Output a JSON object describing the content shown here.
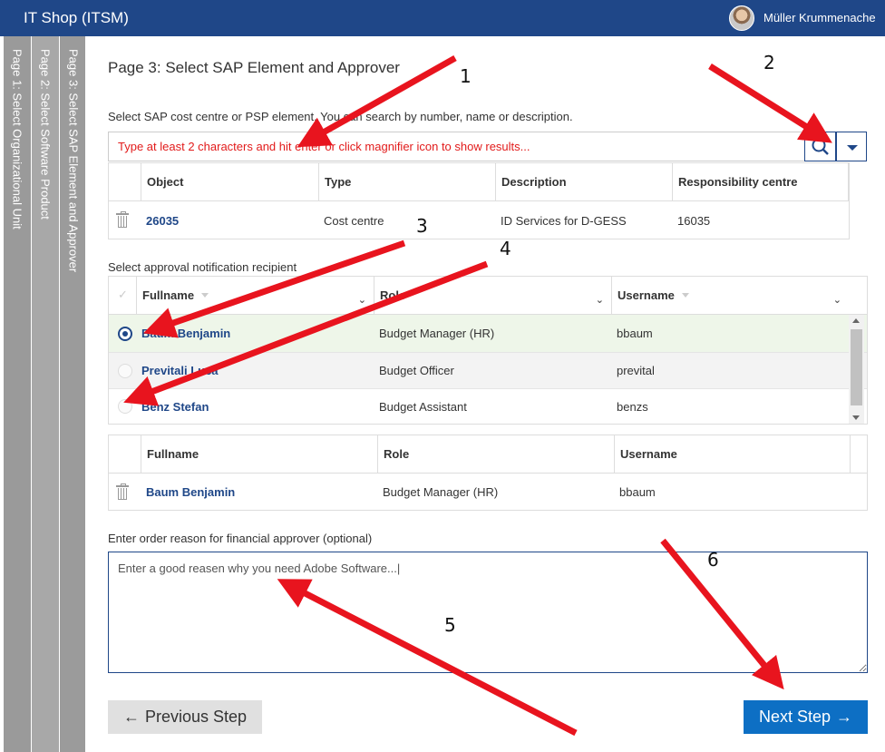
{
  "header": {
    "app_title": "IT Shop (ITSM)",
    "user_name": "Müller Krummenache"
  },
  "steps": [
    {
      "label": "Page 1: Select Organizational Unit"
    },
    {
      "label": "Page 2: Select Software Product"
    },
    {
      "label": "Page 3: Select SAP Element and Approver"
    }
  ],
  "page": {
    "title": "Page 3: Select SAP Element and Approver",
    "sap_prompt": "Select SAP cost centre or PSP element. You can search by number, name or description.",
    "sap_search_placeholder": "Type at least 2 characters and hit enter or click magnifier icon to show results...",
    "approval_prompt": "Select approval notification recipient",
    "reason_prompt": "Enter order reason for financial approver (optional)",
    "reason_value": "Enter a good reasen why you need Adobe Software...|"
  },
  "sap_table": {
    "columns": [
      "Object",
      "Type",
      "Description",
      "Responsibility centre"
    ],
    "rows": [
      {
        "object": "26035",
        "type": "Cost centre",
        "description": "ID Services for D-GESS",
        "responsibility": "16035"
      }
    ]
  },
  "approver_table": {
    "columns": [
      "Fullname",
      "Role",
      "Username"
    ],
    "rows": [
      {
        "fullname": "Baum Benjamin",
        "role": "Budget Manager (HR)",
        "username": "bbaum",
        "selected": true
      },
      {
        "fullname": "Previtali Luca",
        "role": "Budget Officer",
        "username": "prevital",
        "selected": false
      },
      {
        "fullname": "Benz Stefan",
        "role": "Budget Assistant",
        "username": "benzs",
        "selected": false
      }
    ]
  },
  "selected_table": {
    "columns": [
      "Fullname",
      "Role",
      "Username"
    ],
    "rows": [
      {
        "fullname": "Baum Benjamin",
        "role": "Budget Manager (HR)",
        "username": "bbaum"
      }
    ]
  },
  "buttons": {
    "previous": "Previous Step",
    "next": "Next Step",
    "arrow_left": "←",
    "arrow_right": "→"
  },
  "annotations": [
    "1",
    "2",
    "3",
    "4",
    "5",
    "6"
  ],
  "colors": {
    "header_bg": "#1f4788",
    "link": "#1f4788",
    "placeholder": "#e21b1b",
    "next_button": "#0d6fc4",
    "annotation_arrow": "#e8141e"
  },
  "icons": [
    "magnifier-icon",
    "dropdown-arrow-icon",
    "trash-icon",
    "radio-icon",
    "arrow-left-icon",
    "arrow-right-icon"
  ]
}
